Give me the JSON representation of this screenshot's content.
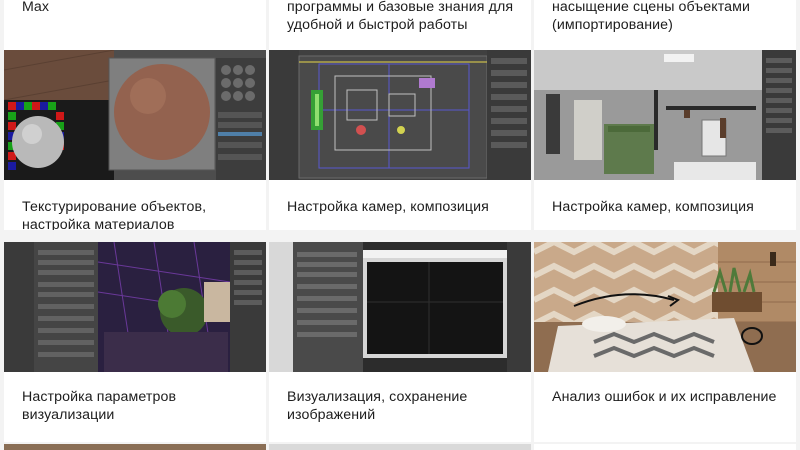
{
  "cards": [
    {
      "id": "top-1",
      "caption": "Max"
    },
    {
      "id": "top-2",
      "caption": "программы и базовые знания для удобной и быстрой работы"
    },
    {
      "id": "top-3",
      "caption": "насыщение сцены объектами (импортирование)"
    },
    {
      "id": "row2-1",
      "caption": "Текстурирование объектов, настройка материалов"
    },
    {
      "id": "row2-2",
      "caption": "Настройка камер, композиция"
    },
    {
      "id": "row2-3",
      "caption": "Настройка камер, композиция"
    },
    {
      "id": "row3-1",
      "caption": "Настройка параметров визуализации"
    },
    {
      "id": "row3-2",
      "caption": "Визуализация, сохранение изображений"
    },
    {
      "id": "row3-3",
      "caption": "Анализ ошибок и их исправление"
    }
  ],
  "colors": {
    "page_bg": "#f3f3f3",
    "card_bg": "#ffffff",
    "text": "#1d1d1d"
  }
}
